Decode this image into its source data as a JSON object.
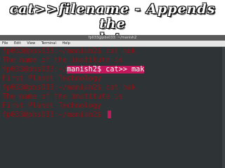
{
  "slide": {
    "title_line1": "cat>>filename - Appends the",
    "title_line2": "data"
  },
  "window": {
    "title": "fp033@pbs033: ~/manish2"
  },
  "menu": {
    "items": [
      "File",
      "Edit",
      "View",
      "Terminal",
      "Help"
    ]
  },
  "terminal": {
    "lines": [
      {
        "prompt": "fp033@pbs033:~/manish2$ ",
        "text": "cat mak"
      },
      {
        "prompt": "",
        "text": "The name of the institute is"
      },
      {
        "prompt": "fp033@pbs033:~/",
        "text": "manish2$ cat>> mak"
      },
      {
        "prompt": "",
        "text": "First Planet Technology"
      },
      {
        "prompt": "fp033@pbs033:~/manish2$ ",
        "text": "cat mak"
      },
      {
        "prompt": "",
        "text": "The name of the institute is"
      },
      {
        "prompt": "",
        "text": "First Planet Technology"
      },
      {
        "prompt": "fp033@pbs033:~/manish2$ ",
        "text": ""
      }
    ]
  }
}
